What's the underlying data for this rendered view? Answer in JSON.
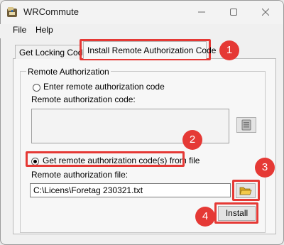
{
  "window": {
    "title": "WRCommute"
  },
  "menu": [
    "File",
    "Help"
  ],
  "tabs": [
    {
      "label": "Get Locking Code"
    },
    {
      "label": "Install Remote Authorization Code"
    }
  ],
  "group": {
    "title": "Remote Authorization",
    "option_enter": "Enter remote authorization code",
    "code_label": "Remote authorization code:",
    "option_file": "Get remote authorization code(s) from file",
    "file_label": "Remote authorization file:",
    "file_value": "C:\\Licens\\Foretag 230321.txt",
    "selected_option": "file"
  },
  "buttons": {
    "install": "Install"
  },
  "badges": [
    "1",
    "2",
    "3",
    "4"
  ],
  "colors": {
    "annotation": "#e53935",
    "window_bg": "#f0f0f0"
  }
}
